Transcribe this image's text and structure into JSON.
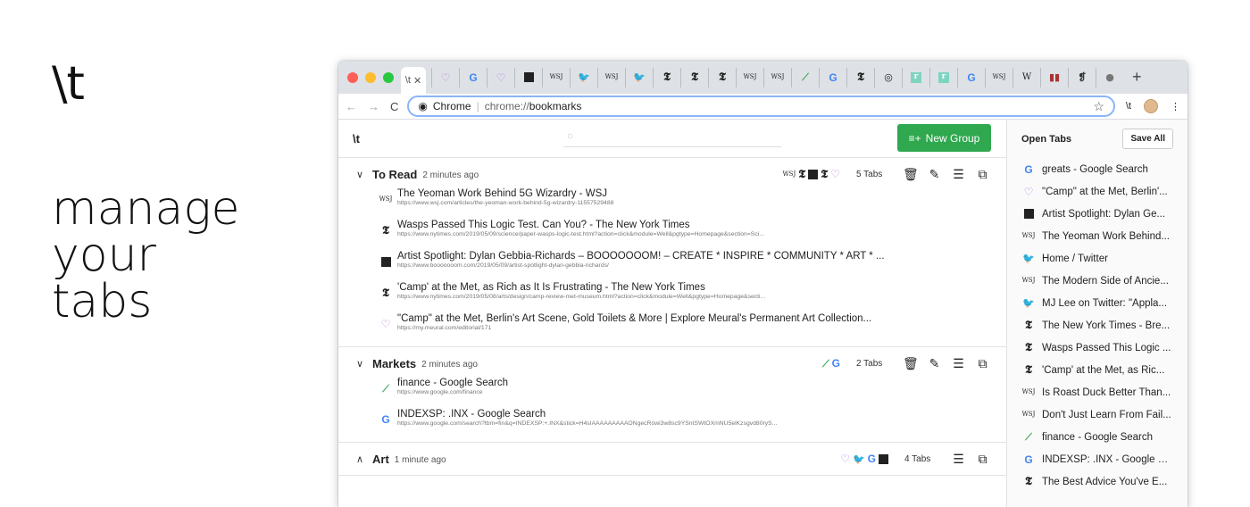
{
  "hero": {
    "logo": "\\t",
    "tagline": [
      "manage",
      "your",
      "tabs"
    ]
  },
  "browser": {
    "active_tab_label": "\\t",
    "tab_icons": [
      "meural-icon",
      "google-icon",
      "meural-icon",
      "boooom-icon",
      "wsj-icon",
      "twitter-icon",
      "wsj-icon",
      "twitter-icon",
      "nyt-icon",
      "nyt-icon",
      "nyt-icon",
      "wsj-icon",
      "wsj-icon",
      "finance-icon",
      "google-icon",
      "nyt-icon",
      "circle-g-icon",
      "r-icon",
      "r-icon",
      "google-icon",
      "wsj-icon",
      "wikipedia-icon",
      "bars-icon",
      "genius-icon",
      "apple-icon"
    ],
    "omnibox": {
      "site": "Chrome",
      "url_prefix": "chrome://",
      "url_path": "bookmarks"
    },
    "extension_label": "\\t"
  },
  "app": {
    "logo": "\\t",
    "search_placeholder": "",
    "new_group_label": "New Group",
    "groups": [
      {
        "name": "To Read",
        "time": "2 minutes ago",
        "count": "5 Tabs",
        "expanded": true,
        "icons": [
          "wsj",
          "nyt",
          "boooom",
          "nyt",
          "meural"
        ],
        "links": [
          {
            "icon": "wsj",
            "title": "The Yeoman Work Behind 5G Wizardry - WSJ",
            "url": "https://www.wsj.com/articles/the-yeoman-work-behind-5g-wizardry-11557529488"
          },
          {
            "icon": "nyt",
            "title": "Wasps Passed This Logic Test. Can You? - The New York Times",
            "url": "https://www.nytimes.com/2019/05/09/science/paper-wasps-logic-test.html?action=click&module=Well&pgtype=Homepage&section=Sci..."
          },
          {
            "icon": "boooom",
            "title": "Artist Spotlight: Dylan Gebbia-Richards – BOOOOOOOM! – CREATE * INSPIRE * COMMUNITY * ART * ...",
            "url": "https://www.booooooom.com/2019/05/09/artist-spotlight-dylan-gebbia-richards/"
          },
          {
            "icon": "nyt",
            "title": "'Camp' at the Met, as Rich as It Is Frustrating - The New York Times",
            "url": "https://www.nytimes.com/2019/05/08/arts/design/camp-review-met-museum.html?action=click&module=Well&pgtype=Homepage&secti..."
          },
          {
            "icon": "meural",
            "title": "\"Camp\" at the Met, Berlin's Art Scene, Gold Toilets & More | Explore Meural's Permanent Art Collection...",
            "url": "https://my.meural.com/editorial/171"
          }
        ]
      },
      {
        "name": "Markets",
        "time": "2 minutes ago",
        "count": "2 Tabs",
        "expanded": true,
        "icons": [
          "finance",
          "google"
        ],
        "links": [
          {
            "icon": "finance",
            "title": "finance - Google Search",
            "url": "https://www.google.com/finance"
          },
          {
            "icon": "google",
            "title": "INDEXSP: .INX - Google Search",
            "url": "https://www.google.com/search?tbm=fin&q=INDEXSP:+.INX&stick=H4sIAAAAAAAAAONgecRowi3w8sc9YSntSWtOXmNU5elKzsgvd80ryS..."
          }
        ]
      },
      {
        "name": "Art",
        "time": "1 minute ago",
        "count": "4 Tabs",
        "expanded": false,
        "icons": [
          "meural",
          "twitter",
          "google",
          "boooom"
        ],
        "links": []
      }
    ]
  },
  "sidebar": {
    "title": "Open Tabs",
    "save_all_label": "Save All",
    "tabs": [
      {
        "icon": "google",
        "title": "greats - Google Search"
      },
      {
        "icon": "meural",
        "title": "\"Camp\" at the Met, Berlin'..."
      },
      {
        "icon": "boooom",
        "title": "Artist Spotlight: Dylan Ge..."
      },
      {
        "icon": "wsj",
        "title": "The Yeoman Work Behind..."
      },
      {
        "icon": "twitter",
        "title": "Home / Twitter"
      },
      {
        "icon": "wsj",
        "title": "The Modern Side of Ancie..."
      },
      {
        "icon": "twitter",
        "title": "MJ Lee on Twitter: \"Appla..."
      },
      {
        "icon": "nyt",
        "title": "The New York Times - Bre..."
      },
      {
        "icon": "nyt",
        "title": "Wasps Passed This Logic ..."
      },
      {
        "icon": "nyt",
        "title": "'Camp' at the Met, as Ric..."
      },
      {
        "icon": "wsj",
        "title": "Is Roast Duck Better Than..."
      },
      {
        "icon": "wsj",
        "title": "Don't Just Learn From Fail..."
      },
      {
        "icon": "finance",
        "title": "finance - Google Search"
      },
      {
        "icon": "google",
        "title": "INDEXSP: .INX - Google S..."
      },
      {
        "icon": "nyt",
        "title": "The Best Advice You've E..."
      }
    ]
  }
}
